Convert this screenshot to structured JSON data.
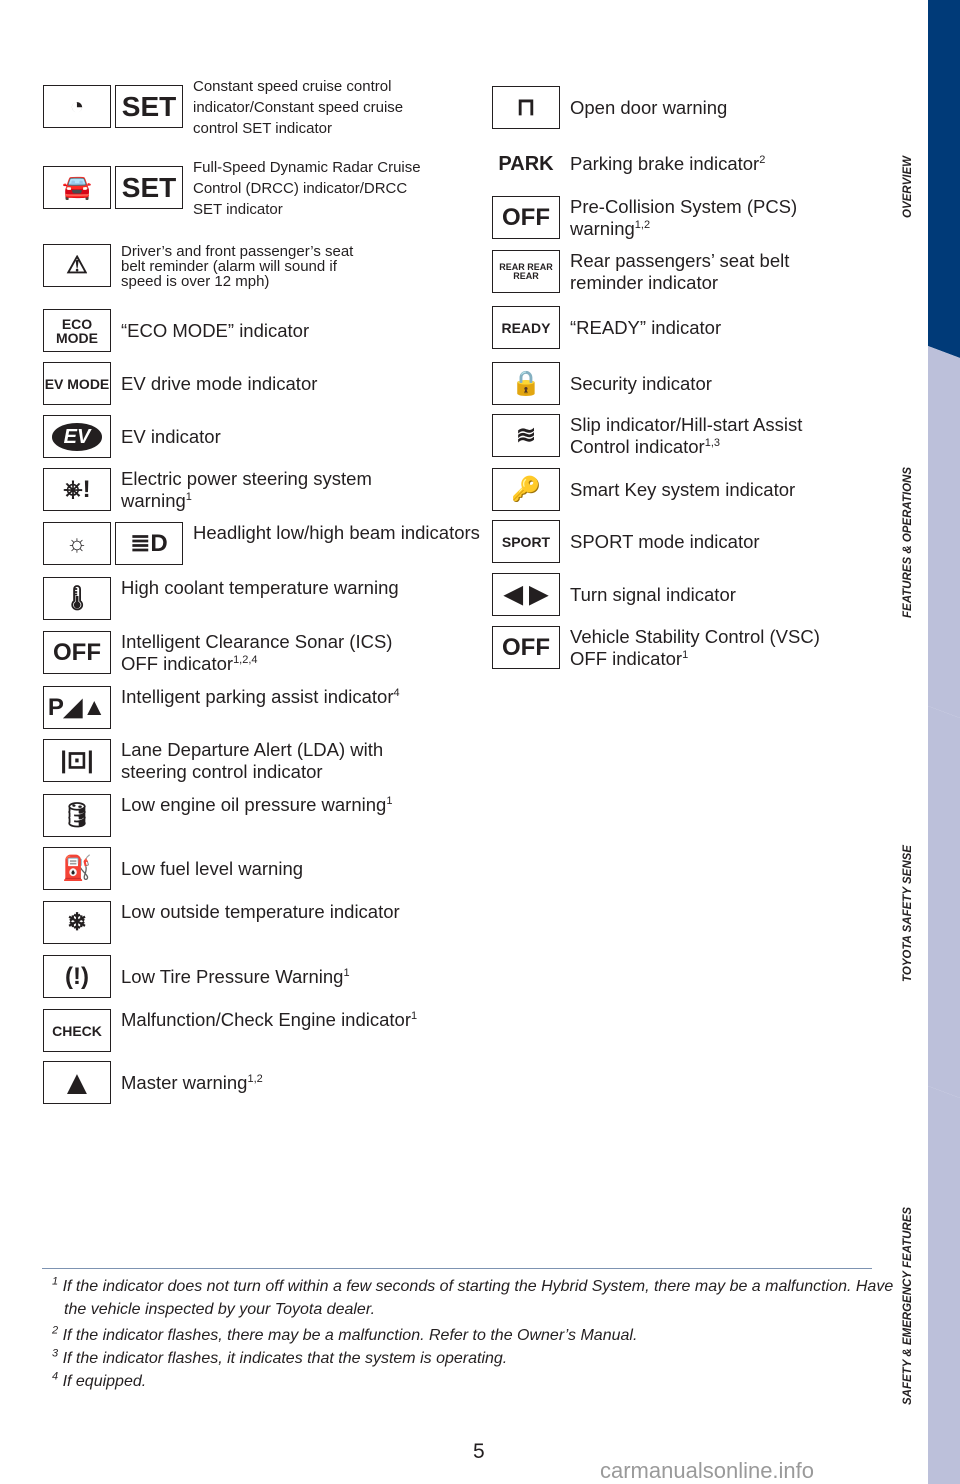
{
  "left_items": [
    {
      "icons": [
        {
          "name": "cruise-control-icon",
          "glyph": "◔"
        },
        {
          "name": "set-icon",
          "glyph": "SET"
        }
      ],
      "label": "Constant speed cruise control indicator/Constant speed cruise control SET indicator",
      "sup": "",
      "size": "small"
    },
    {
      "icons": [
        {
          "name": "radar-cruise-icon",
          "glyph": "🚘"
        },
        {
          "name": "set-icon",
          "glyph": "SET"
        }
      ],
      "label": "Full-Speed Dynamic Radar Cruise Control (DRCC) indicator/DRCC SET indicator",
      "sup": "",
      "size": "small"
    },
    {
      "icons": [
        {
          "name": "seat-belt-icon",
          "glyph": "⚠"
        }
      ],
      "label": "Driver’s and front passenger’s seat belt reminder (alarm will sound if speed is over 12 mph)",
      "sup": "",
      "size": "tiny"
    },
    {
      "icons": [
        {
          "name": "eco-mode-icon",
          "glyph": "ECO MODE"
        }
      ],
      "label": "“ECO MODE” indicator",
      "sup": ""
    },
    {
      "icons": [
        {
          "name": "ev-mode-icon",
          "glyph": "EV MODE"
        }
      ],
      "label": "EV drive mode indicator",
      "sup": ""
    },
    {
      "icons": [
        {
          "name": "ev-icon",
          "glyph": "EV"
        }
      ],
      "label": "EV indicator",
      "sup": ""
    },
    {
      "icons": [
        {
          "name": "steering-warning-icon",
          "glyph": "⎈!"
        }
      ],
      "label": "Electric power steering system warning",
      "sup": "1"
    },
    {
      "icons": [
        {
          "name": "headlight-low-icon",
          "glyph": "☼"
        },
        {
          "name": "headlight-high-icon",
          "glyph": "≣D"
        }
      ],
      "label": "Headlight low/high beam indicators",
      "sup": ""
    },
    {
      "icons": [
        {
          "name": "coolant-temperature-icon",
          "glyph": "🌡"
        }
      ],
      "label": "High coolant temperature warning",
      "sup": ""
    },
    {
      "icons": [
        {
          "name": "ics-off-icon",
          "glyph": "OFF"
        }
      ],
      "label": "Intelligent Clearance Sonar (ICS) OFF indicator",
      "sup": "1,2,4"
    },
    {
      "icons": [
        {
          "name": "parking-assist-icon",
          "glyph": "P◢▲"
        }
      ],
      "label": "Intelligent parking assist indicator",
      "sup": "4"
    },
    {
      "icons": [
        {
          "name": "lane-departure-icon",
          "glyph": "|⊡|"
        }
      ],
      "label": "Lane Departure Alert (LDA) with steering control indicator",
      "sup": ""
    },
    {
      "icons": [
        {
          "name": "oil-pressure-icon",
          "glyph": "🛢"
        }
      ],
      "label": "Low engine oil pressure warning",
      "sup": "1"
    },
    {
      "icons": [
        {
          "name": "fuel-icon",
          "glyph": "⛽"
        }
      ],
      "label": "Low fuel level warning",
      "sup": ""
    },
    {
      "icons": [
        {
          "name": "outside-temperature-icon",
          "glyph": "❄"
        }
      ],
      "label": "Low outside temperature indicator",
      "sup": ""
    },
    {
      "icons": [
        {
          "name": "tire-pressure-icon",
          "glyph": "(!)"
        }
      ],
      "label": "Low Tire Pressure Warning",
      "sup": "1"
    },
    {
      "icons": [
        {
          "name": "check-engine-icon",
          "glyph": "CHECK"
        }
      ],
      "label": "Malfunction/Check Engine indicator",
      "sup": "1"
    },
    {
      "icons": [
        {
          "name": "master-warning-icon",
          "glyph": "▲"
        }
      ],
      "label": "Master warning",
      "sup": "1,2"
    }
  ],
  "right_items": [
    {
      "icons": [
        {
          "name": "open-door-icon",
          "glyph": "⊓"
        }
      ],
      "label": "Open door warning",
      "sup": ""
    },
    {
      "icons": [
        {
          "name": "park-icon",
          "glyph": "PARK"
        }
      ],
      "label": "Parking brake indicator",
      "sup": "2"
    },
    {
      "icons": [
        {
          "name": "pcs-icon",
          "glyph": "OFF"
        }
      ],
      "label": "Pre-Collision System (PCS) warning",
      "sup": "1,2"
    },
    {
      "icons": [
        {
          "name": "rear-seat-belt-icon",
          "glyph": "REAR REAR REAR"
        }
      ],
      "label": "Rear passengers’ seat belt reminder indicator",
      "sup": ""
    },
    {
      "icons": [
        {
          "name": "ready-icon",
          "glyph": "READY"
        }
      ],
      "label": "“READY” indicator",
      "sup": ""
    },
    {
      "icons": [
        {
          "name": "security-icon",
          "glyph": "🔒"
        }
      ],
      "label": "Security indicator",
      "sup": ""
    },
    {
      "icons": [
        {
          "name": "slip-icon",
          "glyph": "≋"
        }
      ],
      "label": "Slip indicator/Hill-start Assist Control indicator",
      "sup": "1,3"
    },
    {
      "icons": [
        {
          "name": "smart-key-icon",
          "glyph": "🔑"
        }
      ],
      "label": "Smart Key system indicator",
      "sup": ""
    },
    {
      "icons": [
        {
          "name": "sport-icon",
          "glyph": "SPORT"
        }
      ],
      "label": "SPORT mode indicator",
      "sup": ""
    },
    {
      "icons": [
        {
          "name": "turn-signal-icon",
          "glyph": "◀ ▶"
        }
      ],
      "label": "Turn signal indicator",
      "sup": ""
    },
    {
      "icons": [
        {
          "name": "vsc-off-icon",
          "glyph": "OFF"
        }
      ],
      "label": "Vehicle Stability Control (VSC) OFF indicator",
      "sup": "1"
    }
  ],
  "tabs": [
    {
      "label": "OVERVIEW",
      "active": true
    },
    {
      "label": "FEATURES & OPERATIONS",
      "active": false
    },
    {
      "label": "TOYOTA SAFETY SENSE",
      "active": false
    },
    {
      "label": "SAFETY & EMERGENCY FEATURES",
      "active": false
    }
  ],
  "footnotes": [
    {
      "num": "1",
      "text": "If the indicator does not turn off within a few seconds of starting the Hybrid System, there may be a malfunction. Have the vehicle inspected by your Toyota dealer."
    },
    {
      "num": "2",
      "text": "If the indicator flashes, there may be a malfunction. Refer to the Owner’s Manual."
    },
    {
      "num": "3",
      "text": "If the indicator flashes, it indicates that the system is operating."
    },
    {
      "num": "4",
      "text": "If equipped."
    }
  ],
  "page_number": "5",
  "watermark": "carmanualsonline.info",
  "colors": {
    "tab_active": "#003a78",
    "tab_inactive": "#bcc0da",
    "rule": "#7d93b2"
  }
}
